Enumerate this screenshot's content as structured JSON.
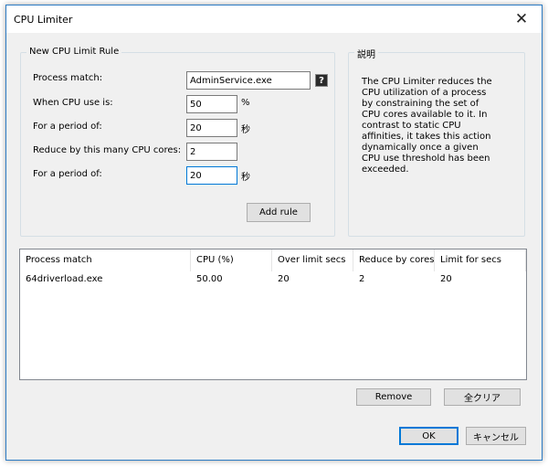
{
  "window": {
    "title": "CPU Limiter",
    "close_icon": "✕"
  },
  "rule_group": {
    "title": "New CPU Limit Rule",
    "process_match_label": "Process match:",
    "process_match_value": "AdminService.exe",
    "help_icon": "?",
    "cpu_use_label": "When CPU use is:",
    "cpu_use_value": "50",
    "cpu_use_unit": "%",
    "period1_label": "For a period of:",
    "period1_value": "20",
    "period1_unit": "秒",
    "reduce_label": "Reduce by this many CPU cores:",
    "reduce_value": "2",
    "period2_label": "For a period of:",
    "period2_value": "20",
    "period2_unit": "秒",
    "add_rule_label": "Add rule"
  },
  "description": {
    "title": "説明",
    "text": "The CPU Limiter reduces the CPU utilization of a process by constraining the set of CPU cores available to it. In contrast to static CPU affinities, it takes this action dynamically once a given CPU use threshold has been exceeded."
  },
  "rules_table": {
    "columns": [
      "Process match",
      "CPU (%)",
      "Over limit secs",
      "Reduce by cores",
      "Limit for secs"
    ],
    "rows": [
      [
        "64driverload.exe",
        "50.00",
        "20",
        "2",
        "20"
      ]
    ]
  },
  "buttons": {
    "remove": "Remove",
    "clear_all": "全クリア",
    "ok": "OK",
    "cancel": "キャンセル"
  }
}
